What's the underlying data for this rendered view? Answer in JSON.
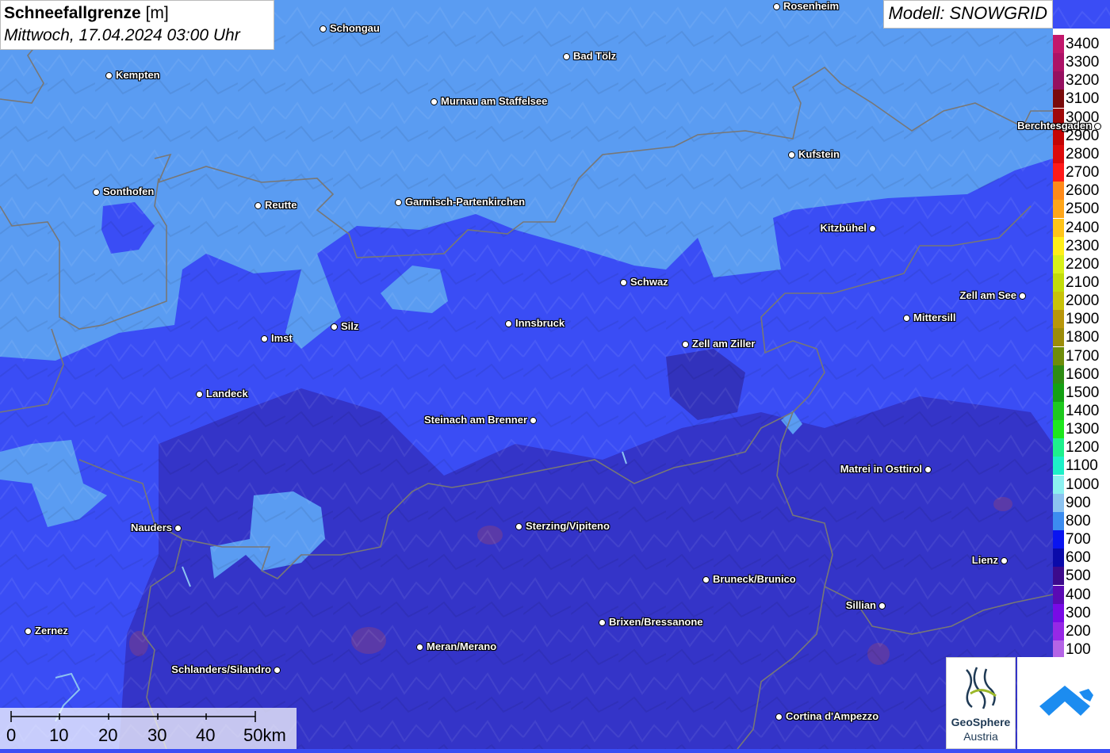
{
  "title": {
    "main": "Schneefallgrenze",
    "unit": "[m]",
    "datetime": "Mittwoch, 17.04.2024 03:00 Uhr"
  },
  "model_label": "Modell: SNOWGRID",
  "legend": {
    "levels": [
      {
        "label": "3400",
        "color": "#c2186b"
      },
      {
        "label": "3300",
        "color": "#ad1266"
      },
      {
        "label": "3200",
        "color": "#961060"
      },
      {
        "label": "3100",
        "color": "#7a0a0a"
      },
      {
        "label": "3000",
        "color": "#a00808"
      },
      {
        "label": "2900",
        "color": "#c40404"
      },
      {
        "label": "2800",
        "color": "#dc0a0a"
      },
      {
        "label": "2700",
        "color": "#ff1a1a"
      },
      {
        "label": "2600",
        "color": "#ff8a1a"
      },
      {
        "label": "2500",
        "color": "#ffa61a"
      },
      {
        "label": "2400",
        "color": "#ffc41a"
      },
      {
        "label": "2300",
        "color": "#ffee1a"
      },
      {
        "label": "2200",
        "color": "#d8f01a"
      },
      {
        "label": "2100",
        "color": "#c2dc0a"
      },
      {
        "label": "2000",
        "color": "#c8c20a"
      },
      {
        "label": "1900",
        "color": "#b8960a"
      },
      {
        "label": "1800",
        "color": "#9c8c0a"
      },
      {
        "label": "1700",
        "color": "#6e8c0a"
      },
      {
        "label": "1600",
        "color": "#2e8c14"
      },
      {
        "label": "1500",
        "color": "#14a014"
      },
      {
        "label": "1400",
        "color": "#1ec81e"
      },
      {
        "label": "1300",
        "color": "#1ee61e"
      },
      {
        "label": "1200",
        "color": "#1ef08c"
      },
      {
        "label": "1100",
        "color": "#1ef0c8"
      },
      {
        "label": "1000",
        "color": "#8cf0f0"
      },
      {
        "label": "900",
        "color": "#8cc2f0"
      },
      {
        "label": "800",
        "color": "#3c8cf0"
      },
      {
        "label": "700",
        "color": "#0a14f0"
      },
      {
        "label": "600",
        "color": "#0a0aaa"
      },
      {
        "label": "500",
        "color": "#3c0a8c"
      },
      {
        "label": "400",
        "color": "#5a0ab4"
      },
      {
        "label": "300",
        "color": "#780ae6"
      },
      {
        "label": "200",
        "color": "#9628e6"
      },
      {
        "label": "100",
        "color": "#b464e6"
      }
    ]
  },
  "cities": [
    {
      "name": "Rosenheim"
    },
    {
      "name": "Schongau"
    },
    {
      "name": "Kempten"
    },
    {
      "name": "Bad Tölz"
    },
    {
      "name": "Murnau am Staffelsee"
    },
    {
      "name": "Berchtesgaden"
    },
    {
      "name": "Kufstein"
    },
    {
      "name": "Sonthofen"
    },
    {
      "name": "Reutte"
    },
    {
      "name": "Garmisch-Partenkirchen"
    },
    {
      "name": "Kitzbühel"
    },
    {
      "name": "Schwaz"
    },
    {
      "name": "Zell am See"
    },
    {
      "name": "Silz"
    },
    {
      "name": "Innsbruck"
    },
    {
      "name": "Imst"
    },
    {
      "name": "Mittersill"
    },
    {
      "name": "Zell am Ziller"
    },
    {
      "name": "Landeck"
    },
    {
      "name": "Steinach am Brenner"
    },
    {
      "name": "Matrei in Osttirol"
    },
    {
      "name": "Nauders"
    },
    {
      "name": "Sterzing/Vipiteno"
    },
    {
      "name": "Lienz"
    },
    {
      "name": "Bruneck/Brunico"
    },
    {
      "name": "Sillian"
    },
    {
      "name": "Brixen/Bressanone"
    },
    {
      "name": "Zernez"
    },
    {
      "name": "Meran/Merano"
    },
    {
      "name": "Schlanders/Silandro"
    },
    {
      "name": "Cortina d'Ampezzo"
    }
  ],
  "scale_bar": {
    "labels": [
      "0",
      "10",
      "20",
      "30",
      "40",
      "50km"
    ]
  },
  "logos": {
    "geosphere_name": "GeoSphere",
    "geosphere_sub": "Austria"
  },
  "colors": {
    "light_zone": "#5a9cf2",
    "mid_zone": "#3a4df5",
    "dark_zone": "#3434c8"
  }
}
